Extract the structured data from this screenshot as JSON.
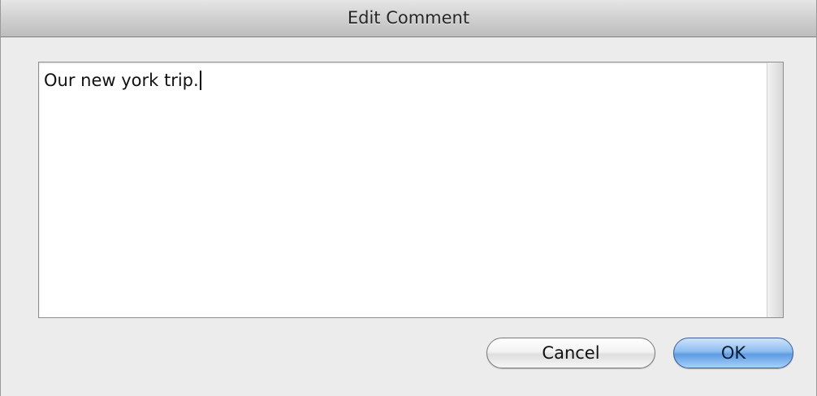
{
  "window": {
    "title": "Edit Comment"
  },
  "comment": {
    "text": "Our new york trip."
  },
  "buttons": {
    "cancel_label": "Cancel",
    "ok_label": "OK"
  },
  "colors": {
    "window_bg": "#ececec",
    "default_button": "#5e9ce3"
  }
}
